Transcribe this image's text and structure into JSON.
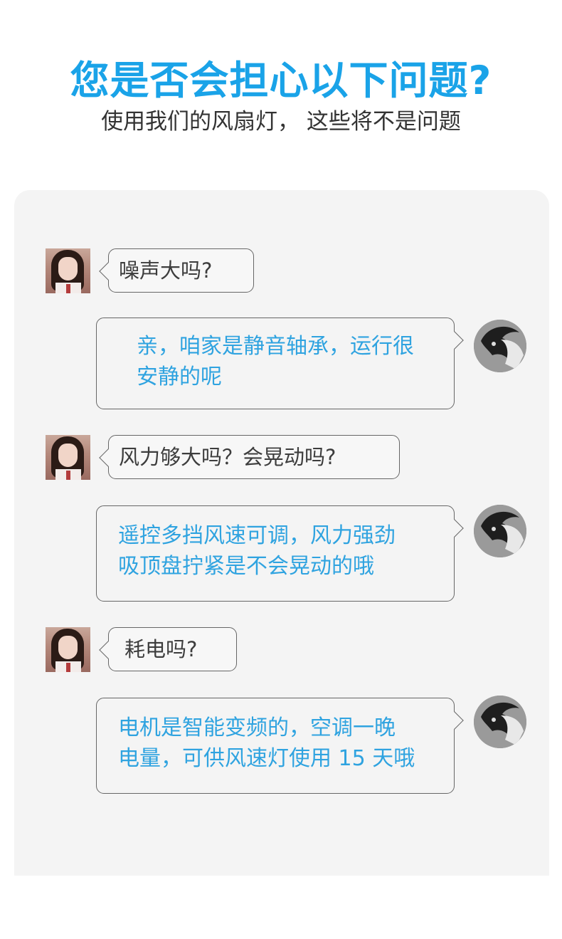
{
  "header": {
    "title": "您是否会担心以下问题?",
    "subtitle": "使用我们的风扇灯， 这些将不是问题"
  },
  "chat": [
    {
      "question": "噪声大吗?",
      "answer": "亲，咱家是静音轴承，运行很\n安静的呢"
    },
    {
      "question": "风力够大吗？会晃动吗?",
      "answer": "遥控多挡风速可调，风力强劲\n吸顶盘拧紧是不会晃动的哦"
    },
    {
      "question": "耗电吗?",
      "answer": "电机是智能变频的，空调一晚\n电量，可供风速灯使用 15 天哦"
    }
  ],
  "colors": {
    "accent": "#1aa3e8",
    "answer_text": "#2fa3e0",
    "panel_bg": "#f4f4f4",
    "question_text": "#3d3d3d"
  },
  "icons": {
    "customer_avatar": "girl-avatar-icon",
    "seller_avatar": "cat-avatar-icon"
  }
}
